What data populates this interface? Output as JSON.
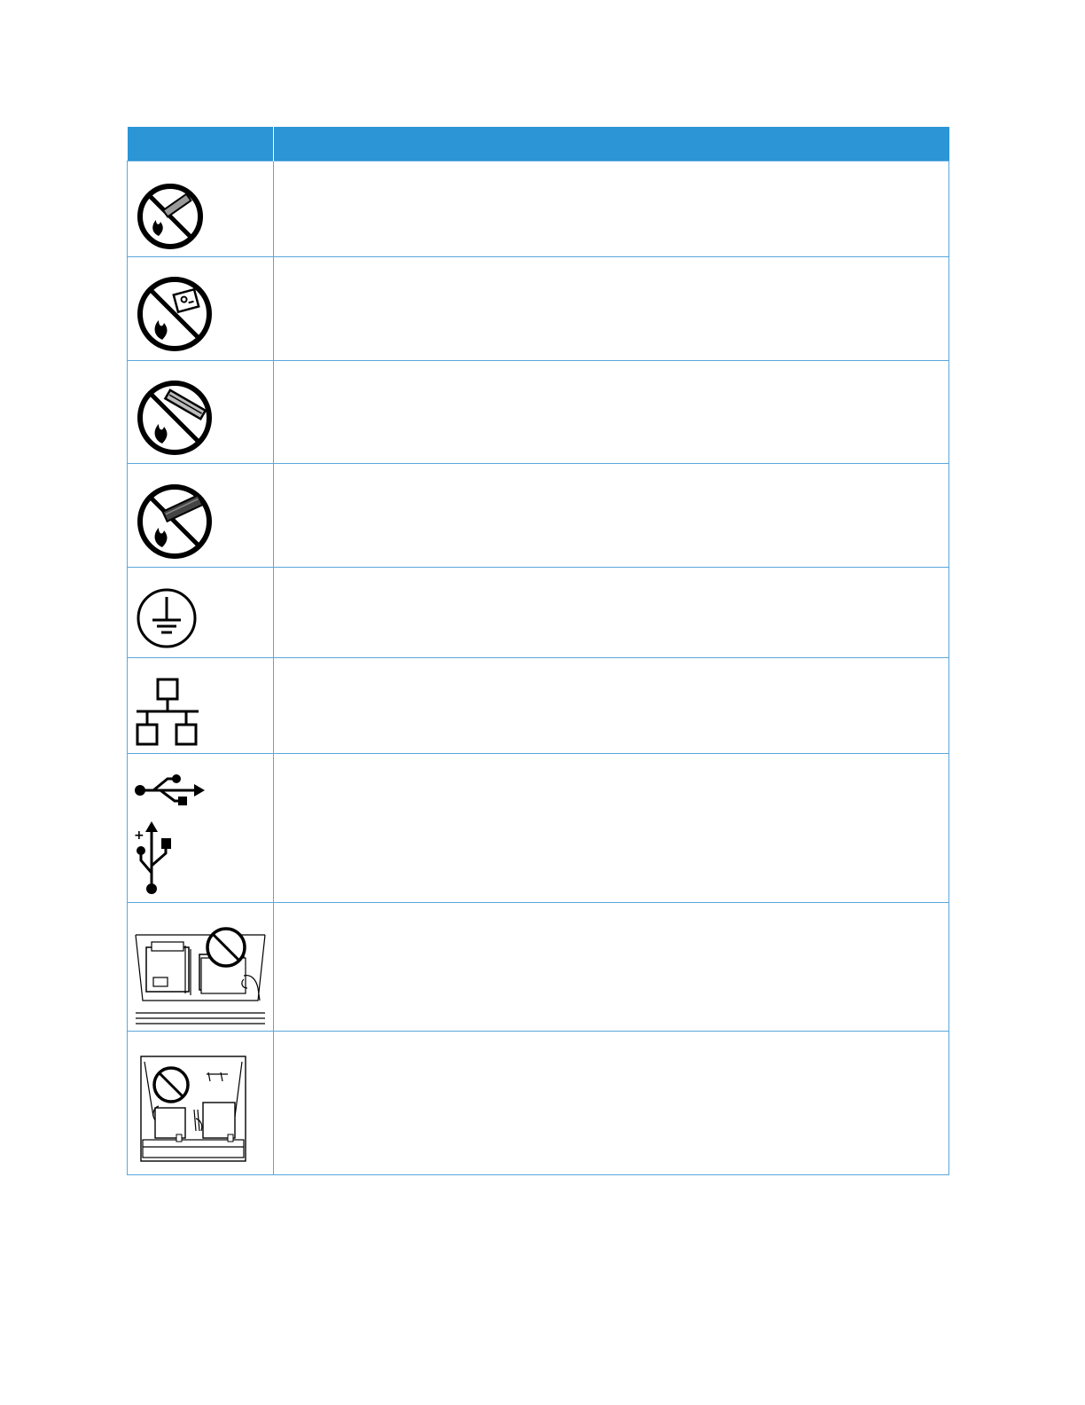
{
  "table": {
    "header": {
      "symbol": "",
      "description": ""
    },
    "rows": [
      {
        "icon": "do-not-burn-toner-cartridge-icon",
        "description": ""
      },
      {
        "icon": "do-not-burn-imaging-unit-icon",
        "description": ""
      },
      {
        "icon": "do-not-burn-drum-cartridge-icon",
        "description": ""
      },
      {
        "icon": "do-not-burn-waste-toner-container-icon",
        "description": ""
      },
      {
        "icon": "protective-earth-ground-icon",
        "description": ""
      },
      {
        "icon": "network-lan-icon",
        "description": ""
      },
      {
        "icon": "usb-icon",
        "description": ""
      },
      {
        "icon": "do-not-load-paper-above-max-fill-icon",
        "description": ""
      },
      {
        "icon": "do-not-touch-tray-area-icon",
        "description": ""
      }
    ]
  }
}
